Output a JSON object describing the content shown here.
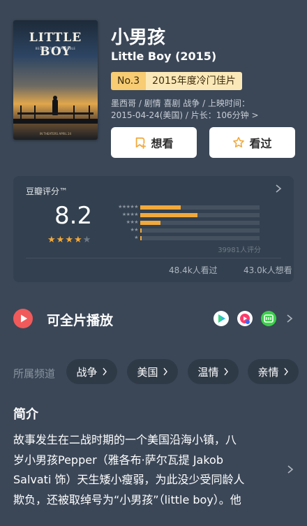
{
  "poster": {
    "title": "LITTLE BOY",
    "tagline": "BELIEVE THE IMPOSSIBLE",
    "date": "IN THEATERS APRIL 24"
  },
  "movie": {
    "title": "小男孩",
    "subtitle": "Little Boy (2015)",
    "rank_no": "No.3",
    "rank_desc": "2015年度冷门佳片",
    "meta_line1": "墨西哥 / 剧情 喜剧 战争 / 上映时间：",
    "meta_line2": "2015-04-24(美国) / 片长：106分钟 >"
  },
  "actions": {
    "want_label": "想看",
    "seen_label": "看过",
    "want_icon": "add-bookmark-icon",
    "seen_icon": "star-outline-icon"
  },
  "rating": {
    "label": "豆瓣评分™",
    "score": "8.2",
    "stars_filled": 4,
    "stars_total": 5,
    "count": "39981人评分",
    "distribution": [
      {
        "stars": "★★★★★",
        "percent": 34
      },
      {
        "stars": "★★★★",
        "percent": 48
      },
      {
        "stars": "★★★",
        "percent": 17
      },
      {
        "stars": "★★",
        "percent": 1
      },
      {
        "stars": "★",
        "percent": 0.5
      }
    ],
    "watched": "48.4k人看过",
    "want": "43.0k人想看"
  },
  "play": {
    "label": "可全片播放",
    "platforms": [
      "platform-a-icon",
      "platform-b-icon",
      "iqiyi-icon"
    ]
  },
  "channels": {
    "label": "所属频道",
    "tags": [
      "战争",
      "美国",
      "温情",
      "亲情"
    ]
  },
  "intro": {
    "title": "简介",
    "lines": [
      "故事发生在二战时期的一个美国沿海小镇，八",
      "岁小男孩Pepper（雅各布·萨尔瓦提 Jakob",
      "Salvati 饰）天生矮小瘦弱，为此没少受同龄人",
      "欺负，还被取绰号为“小男孩”（little boy）。他"
    ]
  },
  "colors": {
    "background": "#3b4757",
    "card": "#33404f",
    "star": "#f2a93b",
    "badge_dark": "#f7cc73",
    "badge_light": "#fbe8b8",
    "play_red": "#f05a5a"
  }
}
